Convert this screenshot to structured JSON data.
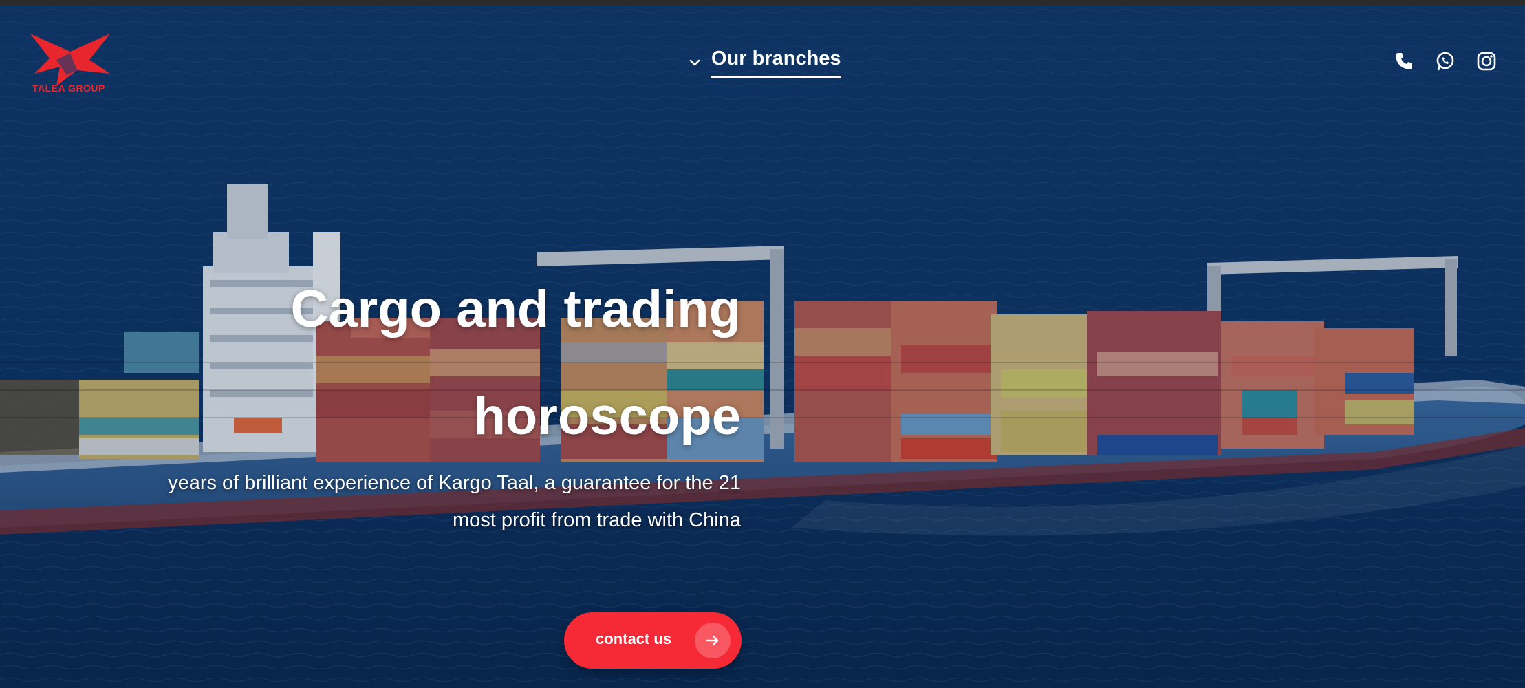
{
  "brand": {
    "logo_text": "TALEA GROUP",
    "accent_color": "#e8262e"
  },
  "nav": {
    "branches_label": "Our branches",
    "chevron_icon": "chevron-down-icon"
  },
  "social": [
    {
      "name": "phone-icon"
    },
    {
      "name": "whatsapp-icon"
    },
    {
      "name": "instagram-icon"
    }
  ],
  "hero": {
    "headline_line1": "Cargo and trading",
    "headline_line2": "horoscope",
    "sub_line1": "years of brilliant experience of Kargo Taal, a guarantee for the 21",
    "sub_line2": "most profit from trade with China",
    "cta_label": "contact us",
    "cta_color": "#f52a36",
    "cta_icon": "arrow-right-icon"
  }
}
